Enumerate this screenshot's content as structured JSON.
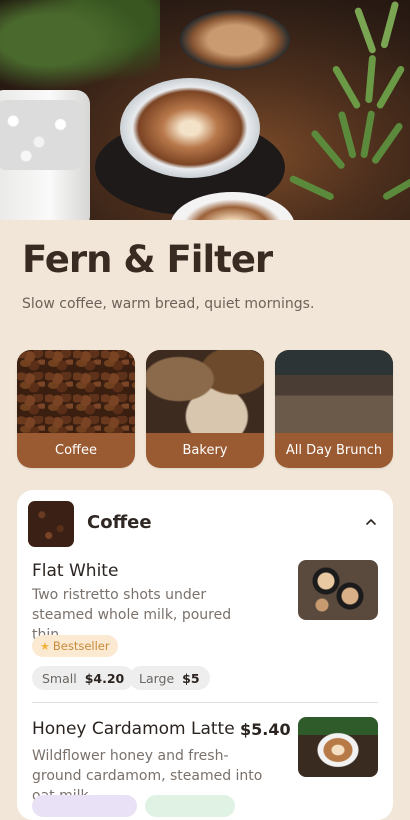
{
  "hero": {
    "image": "latte-cups-and-plants"
  },
  "header": {
    "title": "Fern & Filter",
    "subtitle": "Slow coffee, warm bread, quiet mornings."
  },
  "categories": [
    {
      "label": "Coffee",
      "image": "coffee-beans"
    },
    {
      "label": "Bakery",
      "image": "bread-loaves"
    },
    {
      "label": "All Day Brunch",
      "image": "cafe-interior"
    }
  ],
  "menu": {
    "section_title": "Coffee",
    "items": [
      {
        "name": "Flat White",
        "description": "Two ristretto shots under steamed whole milk, poured thin.",
        "badge": "Bestseller",
        "sizes": [
          {
            "label": "Small",
            "price": "$4.20"
          },
          {
            "label": "Large",
            "price": "$5"
          }
        ]
      },
      {
        "name": "Honey Cardamom Latte",
        "price": "$5.40",
        "description": "Wildflower honey and fresh-ground cardamom, steamed into oat milk."
      }
    ]
  },
  "colors": {
    "background": "#f1e6d7",
    "category_card": "#9b5b32",
    "badge_bg": "#fbe9d2",
    "badge_text": "#c78a3a"
  }
}
